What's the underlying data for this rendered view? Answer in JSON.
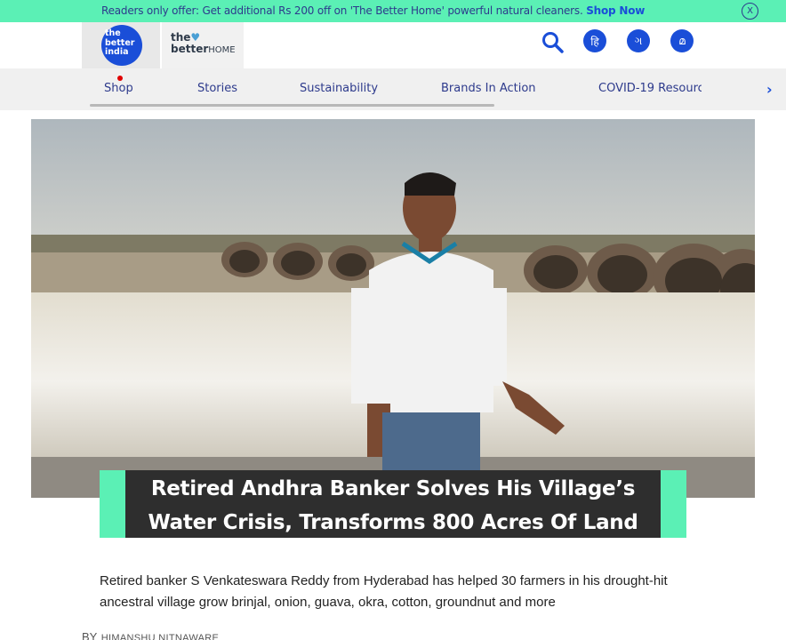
{
  "promo": {
    "text": "Readers only offer: Get additional Rs 200 off on 'The Better Home' powerful natural cleaners.",
    "link": "Shop Now",
    "close": "X"
  },
  "header": {
    "logo_tbi": "the better india",
    "logo_tbh_the": "the",
    "logo_tbh_better": "better",
    "logo_tbh_home": "HOME",
    "lang_hindi": "हि",
    "lang_gujarati": "ગ",
    "lang_malayalam": "മ"
  },
  "nav": {
    "items": [
      "Shop",
      "Stories",
      "Sustainability",
      "Brands In Action",
      "COVID-19 Resourc"
    ],
    "more_arrow": "›"
  },
  "article": {
    "title_line1": "Retired Andhra Banker Solves His Village’s",
    "title_line2": "Water Crisis, Transforms 800 Acres Of Land",
    "subtitle": "Retired banker S Venkateswara Reddy from Hyderabad has helped 30 farmers in his drought-hit ancestral village grow brinjal, onion, guava, okra, cotton, groundnut and more",
    "by": "BY",
    "author": "HIMANSHU NITNAWARE"
  },
  "colors": {
    "accent_green": "#5bf0b5",
    "brand_blue": "#1a4ed8",
    "title_bg": "#2e2e2e"
  },
  "icons": {
    "search": "search-icon",
    "close": "close-icon",
    "next": "chevron-right-icon"
  }
}
